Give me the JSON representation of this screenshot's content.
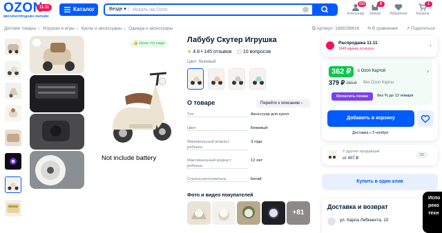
{
  "header": {
    "logo_text": "OZON",
    "logo_badge": "11.11",
    "logo_subtitle": "МЕГАРАСПРОДАЖА ОНЛАЙН",
    "catalog_label": "Каталог",
    "search_scope": "Везде",
    "search_placeholder": "Искать на Ozon",
    "icons": [
      {
        "label": "Александр",
        "badge": "212",
        "icon": "user-icon"
      },
      {
        "label": "Заказы",
        "badge": "8",
        "icon": "box-icon"
      },
      {
        "label": "Избранное",
        "badge": "",
        "icon": "heart-icon"
      },
      {
        "label": "Корзина",
        "badge": "1",
        "icon": "cart-icon"
      }
    ]
  },
  "breadcrumbs": [
    "Детские товары",
    "Игрушки и игры",
    "Куклы и аксессуары",
    "Одежда и аксессуары"
  ],
  "article": "Артикул: 1868298616",
  "compare": "В сравнение",
  "share": "Поделиться",
  "gallery": {
    "price_good_badge": "Цена что надо",
    "caption": "Not include battery"
  },
  "product": {
    "title": "Лабубу Скутер Игрушка",
    "rating": "4.8",
    "reviews": "145 отзывов",
    "questions": "10 вопросов",
    "color_label": "Цвет: бежевый",
    "about_title": "О товаре",
    "description_link": "Перейти к описанию",
    "specs": [
      {
        "key": "Тип",
        "value": "Аксессуар для кукол"
      },
      {
        "key": "Цвет",
        "value": "Бежевый"
      },
      {
        "key": "Минимальный возраст ребенка",
        "value": "3 года"
      },
      {
        "key": "Максимальный возраст ребенка",
        "value": "12 лет"
      },
      {
        "key": "Страна-изготовитель",
        "value": "Китай"
      }
    ],
    "media_title": "Фото и видео покупателей",
    "media_more": "+81"
  },
  "sale": {
    "label": "Распродажа 11.11",
    "sublabel": "1948 единиц осталось"
  },
  "price": {
    "card_price": "362 ₽",
    "card_label": "c Ozon Картой",
    "regular_price": "379 ₽",
    "old_price": "780 ₽",
    "regular_label": "без Ozon Карты",
    "later_button": "Оплатить позже",
    "later_text": "без % до 12 января",
    "add_to_cart": "Добавить в корзину",
    "delivery": "Доставка с 5 ноября"
  },
  "other_sellers": {
    "text": "У других продавцов",
    "price": "от 407 ₽",
    "count": "50"
  },
  "one_click": "Купить в один клик",
  "delivery_block": {
    "title": "Доставка и возврат",
    "address": "ул. Карла Либкнехта, 10"
  },
  "floating": [
    "Испо",
    "реко",
    "техн"
  ],
  "colors": {
    "accent": "#005bff",
    "price_green": "#10c44c",
    "badge_pink": "#f91155"
  }
}
